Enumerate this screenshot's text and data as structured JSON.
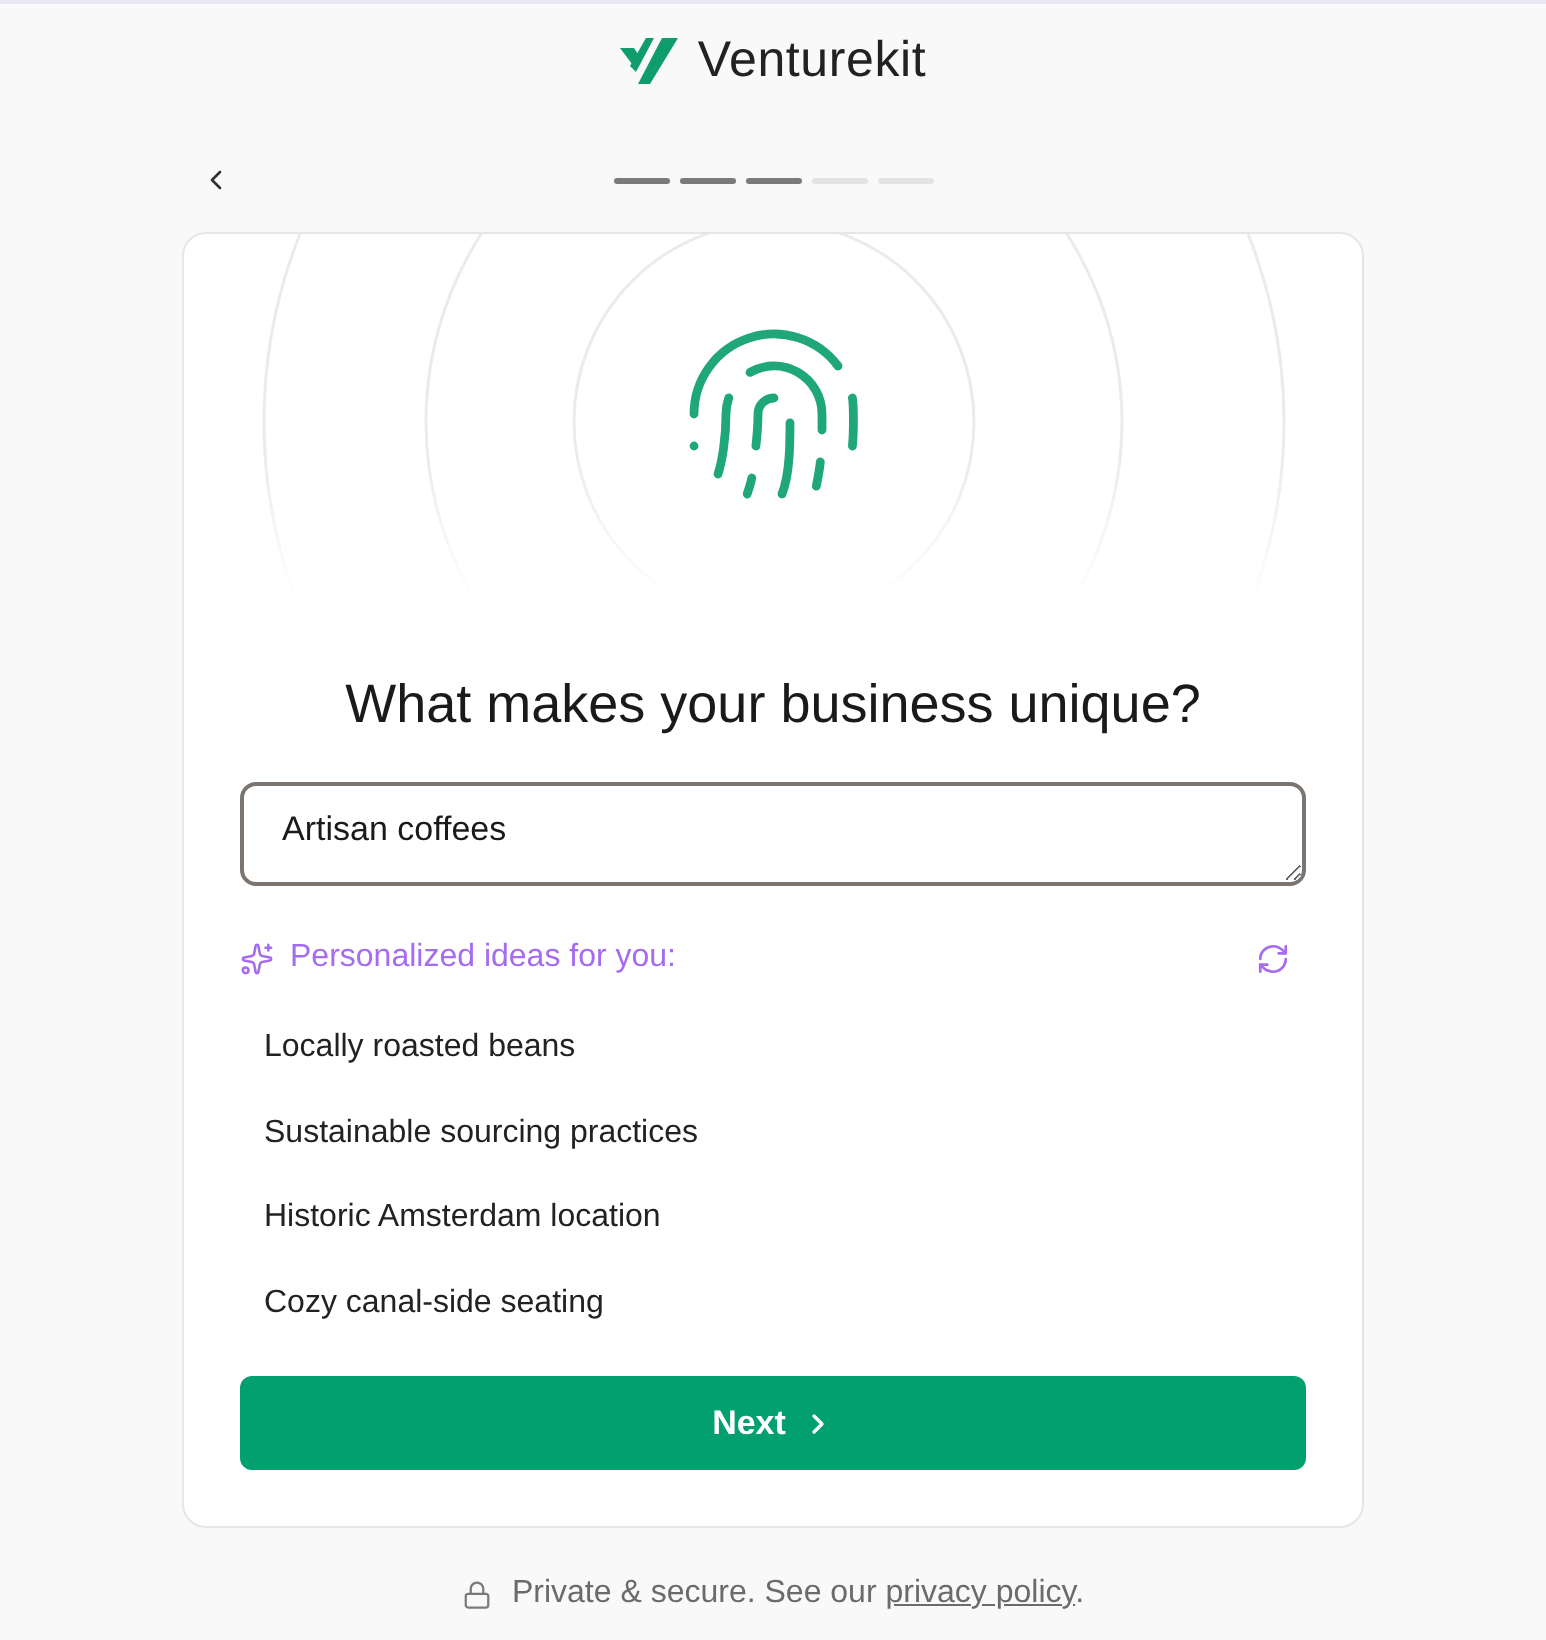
{
  "header": {
    "brand": "Venturekit"
  },
  "nav": {
    "steps": [
      {
        "complete": true
      },
      {
        "complete": true
      },
      {
        "complete": true
      },
      {
        "complete": false
      },
      {
        "complete": false
      }
    ]
  },
  "card": {
    "heading": "What makes your business unique?",
    "answer": {
      "value": "Artisan coffees"
    },
    "ideas": {
      "title": "Personalized ideas for you:",
      "items": [
        "Locally roasted beans",
        "Sustainable sourcing practices",
        "Historic Amsterdam location",
        "Cozy canal-side seating"
      ]
    },
    "next_button": {
      "label": "Next"
    }
  },
  "footer": {
    "text": "Private & secure. See our",
    "link": "privacy policy",
    "suffix": "."
  }
}
